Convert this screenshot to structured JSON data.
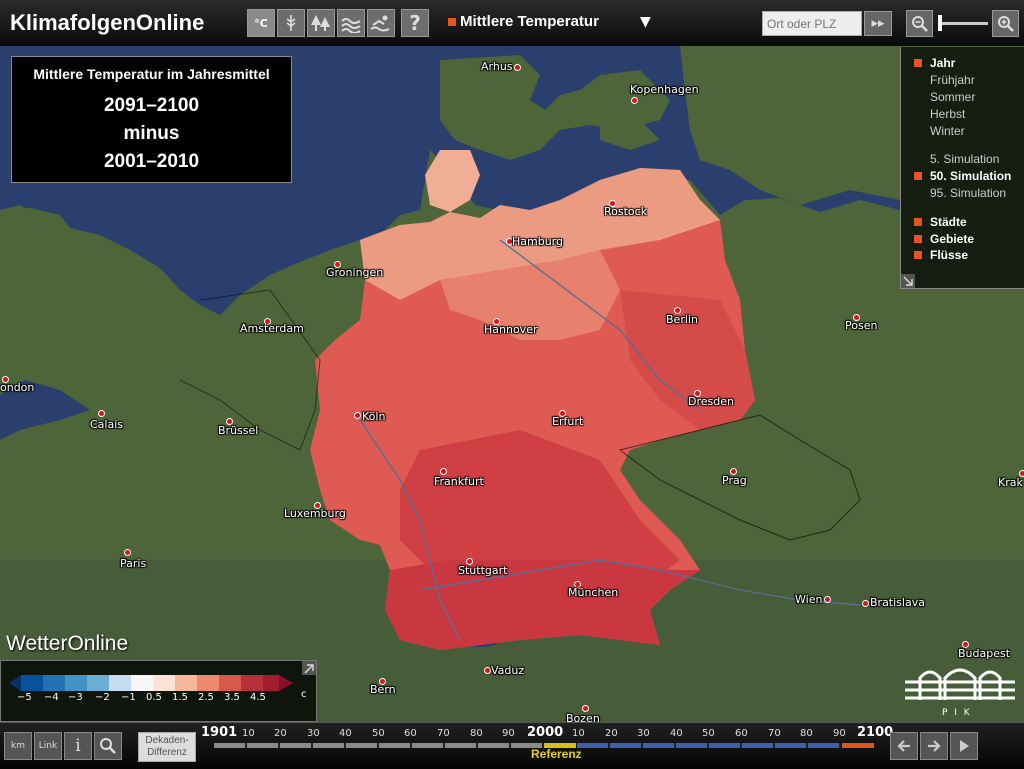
{
  "app": {
    "title": "KlimafolgenOnline"
  },
  "toolbar": {
    "temp_icon_label": "°C",
    "help_label": "?",
    "parameter": "Mittlere Temperatur",
    "search_placeholder": "Ort oder PLZ",
    "go_label": "▸▸"
  },
  "info": {
    "title": "Mittlere Temperatur im Jahresmittel",
    "line1": "2091–2100",
    "line2": "minus",
    "line3": "2001–2010"
  },
  "options": {
    "seasons": [
      {
        "label": "Jahr",
        "selected": true
      },
      {
        "label": "Frühjahr",
        "selected": false
      },
      {
        "label": "Sommer",
        "selected": false
      },
      {
        "label": "Herbst",
        "selected": false
      },
      {
        "label": "Winter",
        "selected": false
      }
    ],
    "simulations": [
      {
        "label": "5. Simulation",
        "selected": false
      },
      {
        "label": "50. Simulation",
        "selected": true
      },
      {
        "label": "95. Simulation",
        "selected": false
      }
    ],
    "layers": [
      {
        "label": "Städte",
        "selected": true
      },
      {
        "label": "Gebiete",
        "selected": true
      },
      {
        "label": "Flüsse",
        "selected": true
      }
    ]
  },
  "cities": [
    "Arhus",
    "Kopenhagen",
    "Rostock",
    "Hamburg",
    "Groningen",
    "Amsterdam",
    "Hannover",
    "Berlin",
    "Posen",
    "ondon",
    "Calais",
    "Brüssel",
    "Köln",
    "Erfurt",
    "Dresden",
    "Frankfurt",
    "Prag",
    "Luxemburg",
    "Paris",
    "Stuttgart",
    "München",
    "Wien",
    "Bratislava",
    "Budapest",
    "Vaduz",
    "Bern",
    "Bozen",
    "Krak"
  ],
  "legend": {
    "labels": [
      "−5",
      "−4",
      "−3",
      "−2",
      "−1",
      "0.5",
      "1.5",
      "2.5",
      "3.5",
      "4.5"
    ],
    "unit": "c",
    "colors": [
      "#08306b",
      "#2166ac",
      "#4393c3",
      "#92c5de",
      "#d1e5f0",
      "#fbe3d6",
      "#f6b79a",
      "#ec8a6c",
      "#d65a4c",
      "#b6303b",
      "#8c0f26"
    ],
    "brand": "WetterOnline"
  },
  "pik_label": "P I K",
  "timeline": {
    "unit_button": "km",
    "link_button": "Link",
    "info_button": "i",
    "dekaden_label": "Dekaden-Differenz",
    "start_year": "1901",
    "mid_year": "2000",
    "end_year": "2100",
    "ticks_before": [
      "10",
      "20",
      "30",
      "40",
      "50",
      "60",
      "70",
      "80",
      "90"
    ],
    "ticks_after": [
      "10",
      "20",
      "30",
      "40",
      "50",
      "60",
      "70",
      "80",
      "90"
    ],
    "reference_label": "Referenz",
    "colors": {
      "past": "#8a8a8a",
      "reference": "#d8c01a",
      "future": "#3a5fb0",
      "selected": "#e0541b"
    }
  },
  "colors": {
    "accent": "#e8541f",
    "water": "#2b3f6e",
    "land": "#4c6338"
  }
}
